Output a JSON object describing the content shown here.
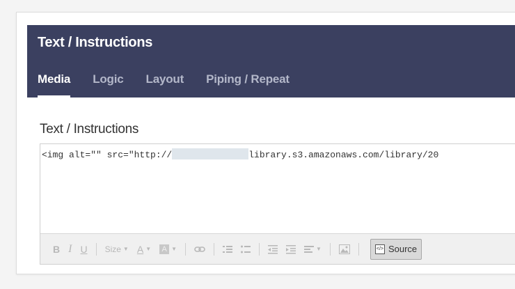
{
  "modal": {
    "title": "Text / Instructions"
  },
  "tabs": [
    {
      "label": "Media",
      "active": true
    },
    {
      "label": "Logic",
      "active": false
    },
    {
      "label": "Layout",
      "active": false
    },
    {
      "label": "Piping / Repeat",
      "active": false
    }
  ],
  "field": {
    "label": "Text / Instructions"
  },
  "editor": {
    "code_prefix": "<img alt=\"\" src=\"http://",
    "code_suffix": "library.s3.amazonaws.com/library/20"
  },
  "toolbar": {
    "bold": "B",
    "italic": "I",
    "underline": "U",
    "size_label": "Size",
    "text_color": "A",
    "bg_color": "A",
    "source_label": "Source"
  },
  "colors": {
    "header_bg": "#3b4060",
    "tab_active": "#ffffff",
    "tab_inactive": "#b3b7c9"
  }
}
